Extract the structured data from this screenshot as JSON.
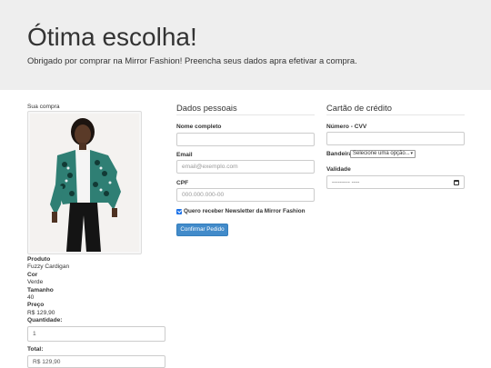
{
  "header": {
    "title": "Ótima escolha!",
    "subtitle": "Obrigado por comprar na Mirror Fashion! Preencha seus dados apra efetivar a compra."
  },
  "purchase": {
    "section_title": "Sua compra",
    "product_label": "Produto",
    "product_value": "Fuzzy Cardigan",
    "color_label": "Cor",
    "color_value": "Verde",
    "size_label": "Tamanho",
    "size_value": "40",
    "price_label": "Preço",
    "price_value": "R$ 129,90",
    "quantity_label": "Quantidade:",
    "quantity_value": "1",
    "total_label": "Total:",
    "total_value": "R$ 129,90"
  },
  "personal": {
    "legend": "Dados pessoais",
    "name_label": "Nome completo",
    "name_value": "",
    "email_label": "Email",
    "email_placeholder": "email@exemplo.com",
    "cpf_label": "CPF",
    "cpf_placeholder": "000.000.000-00",
    "newsletter_label": "Quero receber Newsletter da Mirror Fashion",
    "submit_label": "Confirmar Pedido"
  },
  "card": {
    "legend": "Cartão de crédito",
    "number_label": "Número - CVV",
    "number_value": "",
    "brand_label": "Bandeira",
    "brand_selected": "Selecione uma opção...",
    "validity_label": "Validade",
    "validity_placeholder": "--------- ----"
  },
  "colors": {
    "jumbotron_bg": "#eeeeee",
    "primary_button": "#428bca",
    "checkbox": "#1e73e8"
  }
}
